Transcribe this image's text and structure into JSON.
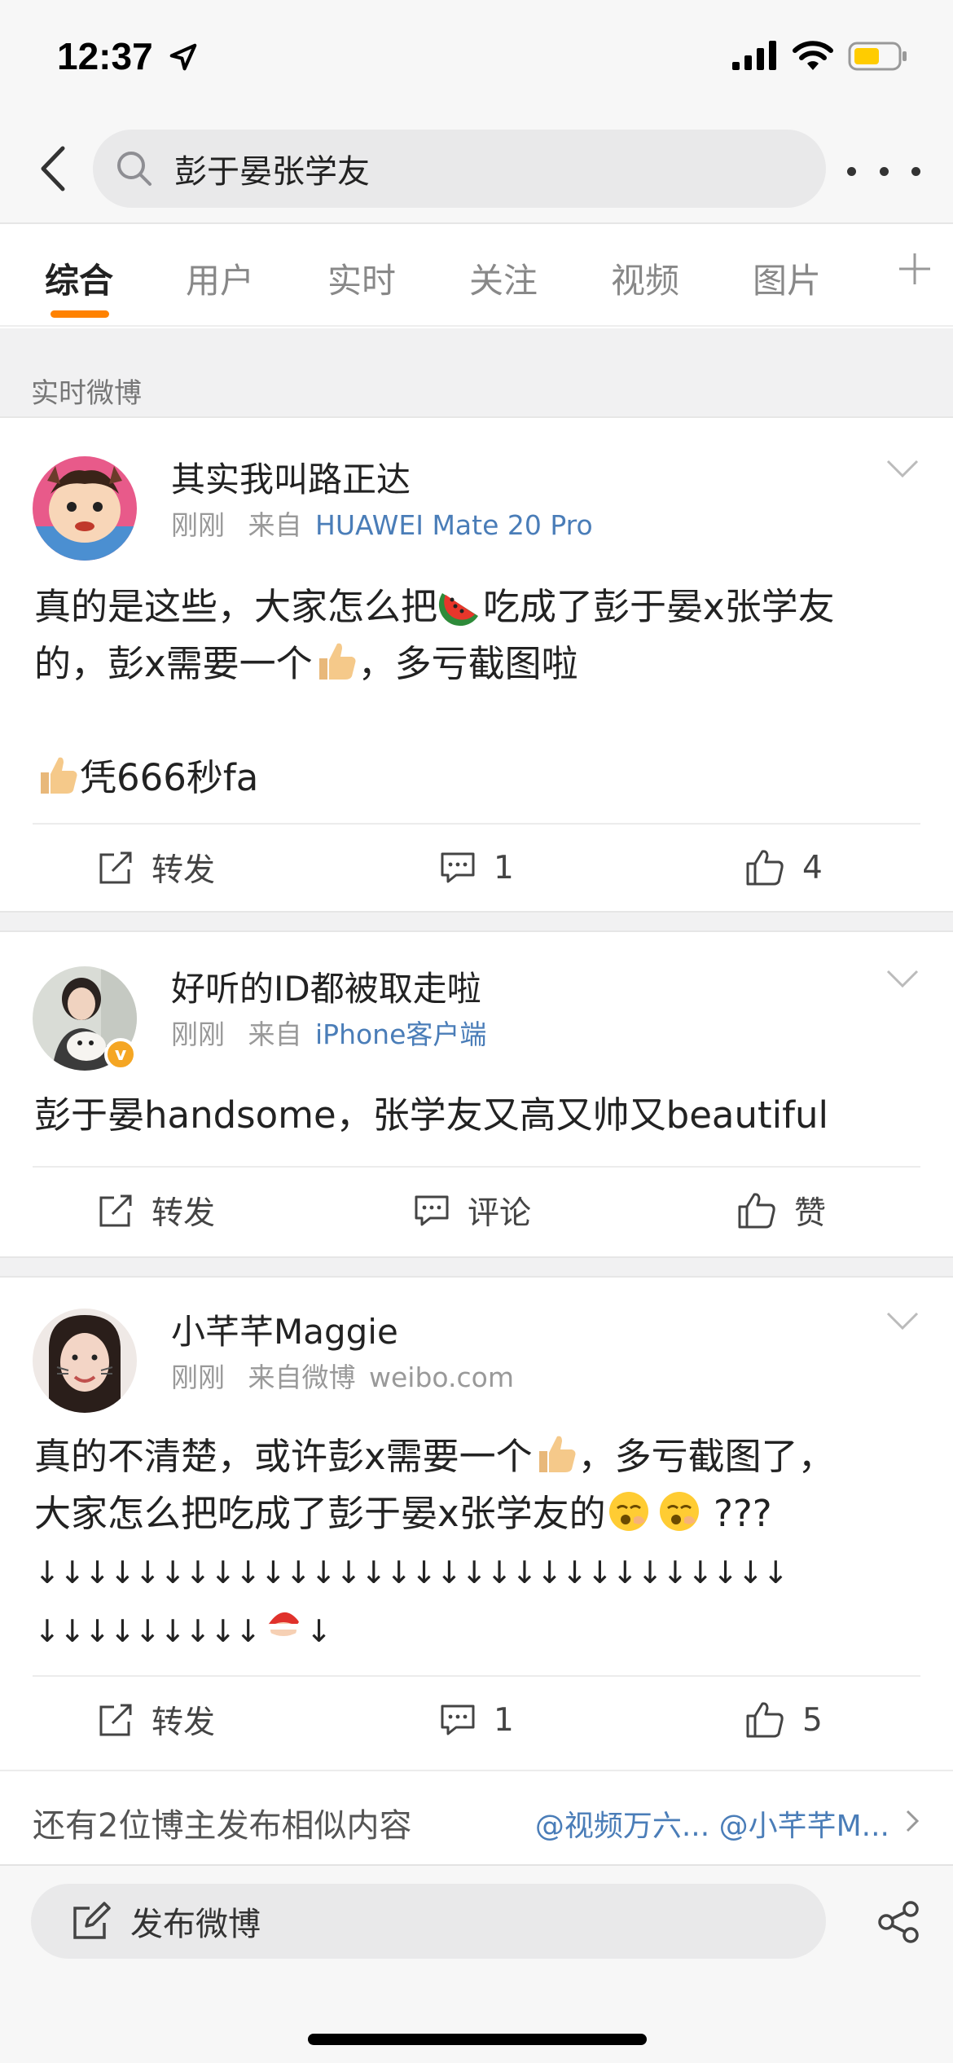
{
  "status_bar": {
    "time": "12:37"
  },
  "search": {
    "query": "彭于晏张学友"
  },
  "tabs": [
    {
      "label": "综合",
      "active": true
    },
    {
      "label": "用户",
      "active": false
    },
    {
      "label": "实时",
      "active": false
    },
    {
      "label": "关注",
      "active": false
    },
    {
      "label": "视频",
      "active": false
    },
    {
      "label": "图片",
      "active": false
    }
  ],
  "section": {
    "title": "实时微博"
  },
  "posts": [
    {
      "username": "其实我叫路正达",
      "time": "刚刚",
      "source_prefix": "来自",
      "source": "HUAWEI Mate 20 Pro",
      "content_lines": [
        "真的是这些，大家怎么把",
        "吃成了彭于晏x张学友",
        "的，彭x需要一个",
        "，多亏截图啦",
        "凭666秒fa"
      ],
      "repost_label": "转发",
      "comment_count": "1",
      "like_count": "4"
    },
    {
      "username": "好听的ID都被取走啦",
      "time": "刚刚",
      "source_prefix": "来自",
      "source": "iPhone客户端",
      "content": "彭于晏handsome，张学友又高又帅又beautiful",
      "repost_label": "转发",
      "comment_label": "评论",
      "like_label": "赞"
    },
    {
      "username": "小芊芊Maggie",
      "time": "刚刚",
      "source_prefix": "来自微博",
      "source": "weibo.com",
      "content_lines": [
        "真的不清楚，或许彭x需要一个",
        "，多亏截图了，",
        "大家怎么把吃成了彭于晏x张学友的",
        "???",
        "↓↓↓↓↓↓↓↓↓↓↓↓↓↓↓↓↓↓↓↓↓↓↓↓↓↓↓↓↓↓",
        "↓↓↓↓↓↓↓↓↓",
        "↓"
      ],
      "repost_label": "转发",
      "comment_count": "1",
      "like_count": "5"
    }
  ],
  "similar": {
    "text": "还有2位博主发布相似内容",
    "links": "@视频万六... @小芊芊M..."
  },
  "compose": {
    "label": "发布微博"
  },
  "colors": {
    "accent": "#ff8200",
    "link": "#4a7db8"
  }
}
